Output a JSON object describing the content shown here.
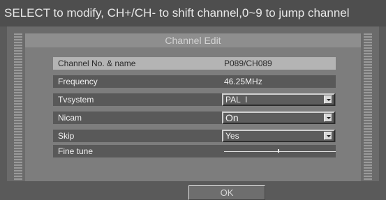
{
  "header": {
    "instructions": "SELECT to modify, CH+/CH- to shift channel,0~9 to jump channel"
  },
  "dialog": {
    "title": "Channel Edit",
    "ok_label": "OK"
  },
  "fields": {
    "channel": {
      "label": "Channel No. & name",
      "value": "P089/CH089"
    },
    "frequency": {
      "label": "Frequency",
      "value": "46.25MHz"
    },
    "tvsystem": {
      "label": "Tvsystem",
      "value": "PAL  I"
    },
    "nicam": {
      "label": "Nicam",
      "value": "On"
    },
    "skip": {
      "label": "Skip",
      "value": "Yes"
    },
    "finetune": {
      "label": "Fine tune",
      "level": 0.48
    }
  },
  "icons": {
    "dropdown": "chevron-down-icon"
  }
}
